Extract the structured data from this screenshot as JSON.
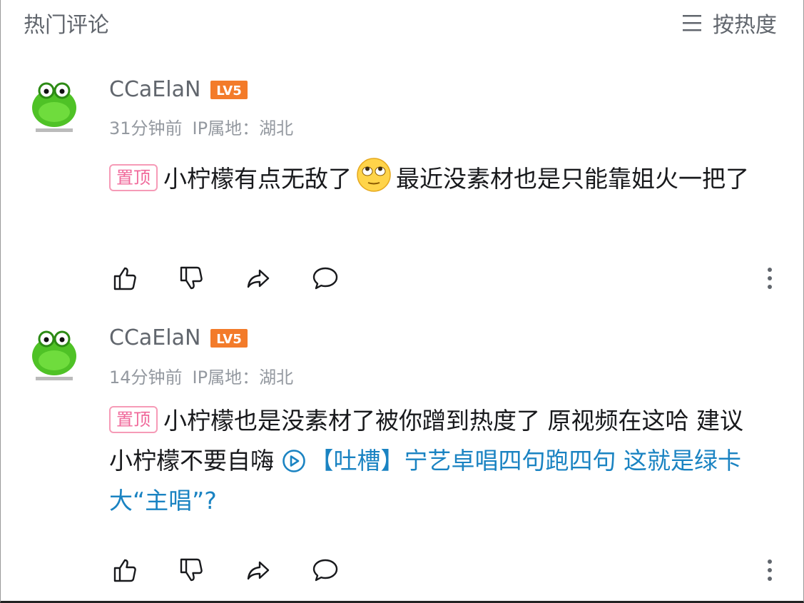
{
  "header": {
    "title": "热门评论",
    "sort_label": "按热度"
  },
  "comments": [
    {
      "username": "CCaElaN",
      "level": "LV5",
      "time": "31分钟前",
      "ip_label": "IP属地：湖北",
      "pinned_label": "置顶",
      "text_before_emoji": "小柠檬有点无敌了",
      "emoji": "eye-roll-emoji",
      "text_after_emoji": "最近没素材也是只能靠姐火一把了"
    },
    {
      "username": "CCaElaN",
      "level": "LV5",
      "time": "14分钟前",
      "ip_label": "IP属地：湖北",
      "pinned_label": "置顶",
      "text": "小柠檬也是没素材了被你蹭到热度了  原视频在这哈 建议小柠檬不要自嗨 ",
      "link_text": "【吐槽】宁艺卓唱四句跑四句 这就是绿卡大“主唱”?"
    }
  ],
  "colors": {
    "pin": "#f0689a",
    "link": "#1a83c2",
    "level_badge": "#f37b2a",
    "avatar_green": "#4fc226"
  }
}
